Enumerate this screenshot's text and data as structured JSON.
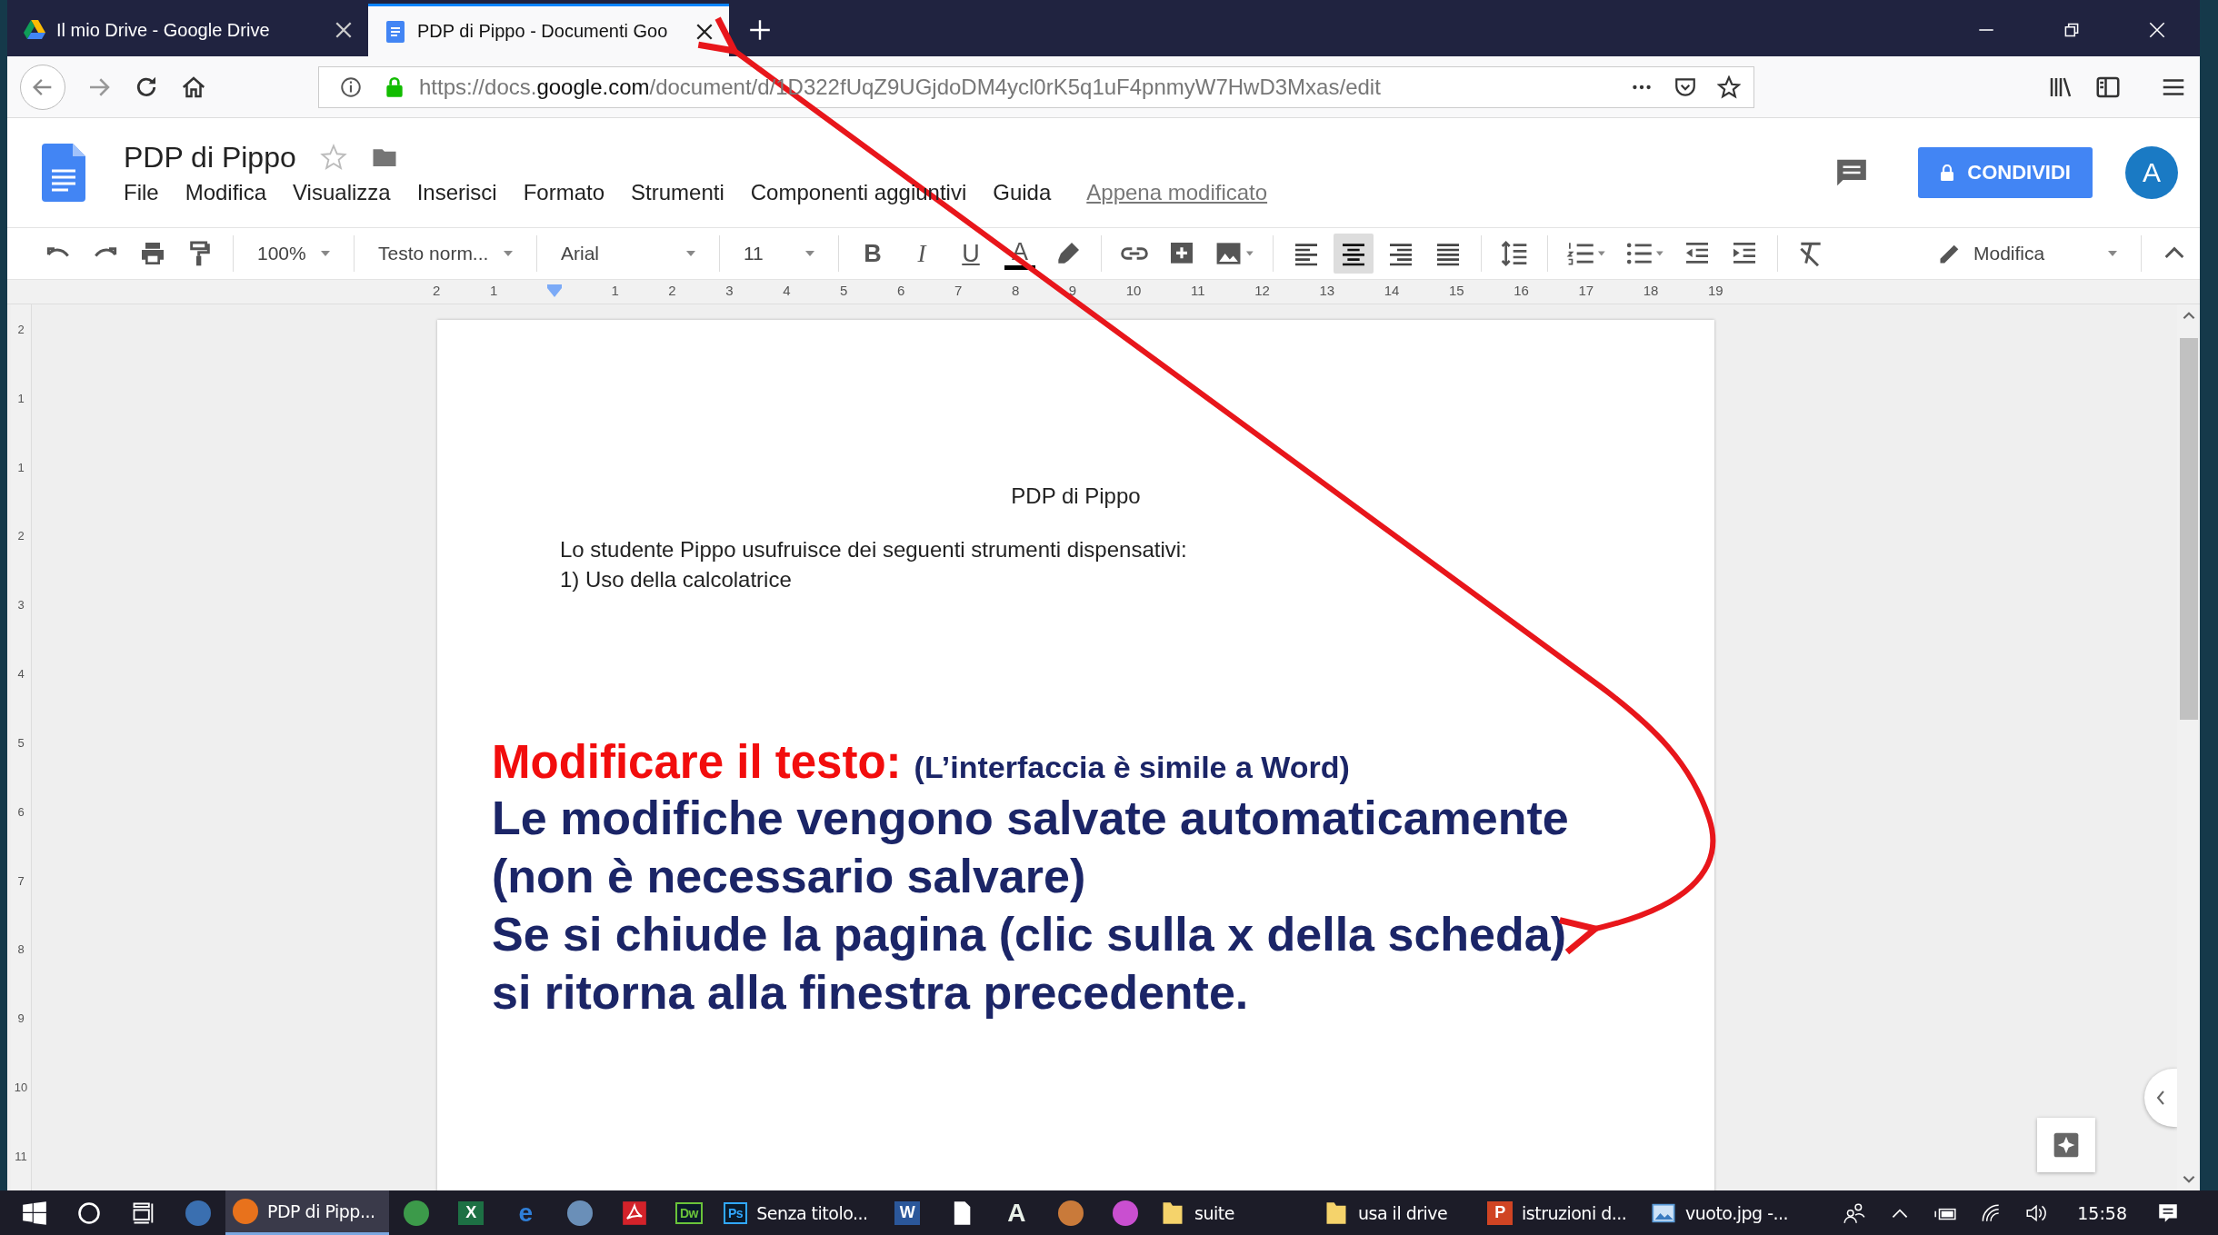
{
  "browser": {
    "tabs": [
      {
        "title": "Il mio Drive - Google Drive",
        "kind": "drive",
        "selected": false
      },
      {
        "title": "PDP di Pippo - Documenti Goo",
        "kind": "docs",
        "selected": true
      }
    ],
    "url": {
      "prefix": "https://docs.",
      "host": "google.com",
      "path": "/document/d/1D322fUqZ9UGjdoDM4ycl0rK5q1uF4pnmyW7HwD3Mxas/edit"
    }
  },
  "docs": {
    "title": "PDP di Pippo",
    "menu": [
      "File",
      "Modifica",
      "Visualizza",
      "Inserisci",
      "Formato",
      "Strumenti",
      "Componenti aggiuntivi",
      "Guida"
    ],
    "last_edit": "Appena modificato",
    "share": "CONDIVIDI",
    "avatar": "A"
  },
  "toolbar": {
    "zoom": "100%",
    "style": "Testo norm...",
    "font": "Arial",
    "size": "11",
    "format": [
      {
        "label": "B",
        "kind": "bold"
      },
      {
        "label": "I",
        "kind": "italic"
      },
      {
        "label": "U",
        "kind": "underline"
      },
      {
        "label": "A",
        "kind": "color"
      }
    ],
    "align": [
      {
        "kind": "left",
        "selected": false
      },
      {
        "kind": "center",
        "selected": true
      },
      {
        "kind": "right",
        "selected": false
      },
      {
        "kind": "justify",
        "selected": false
      }
    ],
    "mode": "Modifica"
  },
  "ruler": {
    "marks": [
      "2",
      "1",
      "1",
      "2",
      "3",
      "4",
      "5",
      "6",
      "7",
      "8",
      "9",
      "10",
      "11",
      "12",
      "13",
      "14",
      "15",
      "16",
      "17",
      "18",
      "19"
    ]
  },
  "vertical_ruler": {
    "marks": [
      "2",
      "1",
      "1",
      "2",
      "3",
      "4",
      "5",
      "6",
      "7",
      "8",
      "9",
      "10",
      "11"
    ]
  },
  "document": {
    "heading": "PDP di Pippo",
    "lines": [
      "Lo studente Pippo usufruisce dei seguenti strumenti dispensativi:",
      "1) Uso della calcolatrice"
    ]
  },
  "annotation": {
    "title": "Modificare il testo:",
    "subtitle": "(L’interfaccia è simile a Word)",
    "lines": [
      "Le modifiche vengono salvate automaticamente",
      "(non è necessario salvare)",
      "Se si chiude la pagina (clic sulla x della scheda)",
      "si ritorna alla finestra precedente."
    ]
  },
  "taskbar": {
    "items": [
      {
        "kind": "start",
        "active": false
      },
      {
        "kind": "search",
        "active": false
      },
      {
        "kind": "taskview",
        "active": false
      },
      {
        "kind": "round",
        "color": "#3a6fb0",
        "active": false
      },
      {
        "kind": "round",
        "color": "#e8721c",
        "label": "PDP di Pipp...",
        "active": true
      },
      {
        "kind": "round",
        "color": "#3c9a4a",
        "active": false
      },
      {
        "kind": "tile",
        "color": "#1d7044",
        "badge": "X",
        "active": false
      },
      {
        "kind": "glyph",
        "color": "#2f7fd8",
        "badge": "e",
        "active": false
      },
      {
        "kind": "round",
        "color": "#6a8fb8",
        "active": false
      },
      {
        "kind": "pdf",
        "color": "#d3222a",
        "active": false
      },
      {
        "kind": "outline",
        "color": "#6ac33a",
        "badge": "Dw",
        "active": false
      },
      {
        "kind": "outline",
        "color": "#31a8ff",
        "badge": "Ps",
        "label": "Senza titolo...",
        "active": false
      },
      {
        "kind": "tile",
        "color": "#2b579a",
        "badge": "W",
        "active": false
      },
      {
        "kind": "doc",
        "active": false
      },
      {
        "kind": "glyph",
        "color": "#e8f0e8",
        "badge": "A",
        "active": false
      },
      {
        "kind": "round",
        "color": "#c97a3a",
        "active": false
      },
      {
        "kind": "round",
        "color": "#c94fd0",
        "active": false
      },
      {
        "kind": "folder",
        "label": "suite",
        "active": false
      },
      {
        "kind": "folder",
        "label": "usa il drive",
        "active": false
      },
      {
        "kind": "tile",
        "color": "#d04423",
        "badge": "P",
        "label": "istruzioni d...",
        "active": false
      },
      {
        "kind": "image",
        "label": "vuoto.jpg -...",
        "active": false
      }
    ],
    "clock": "15:58"
  }
}
